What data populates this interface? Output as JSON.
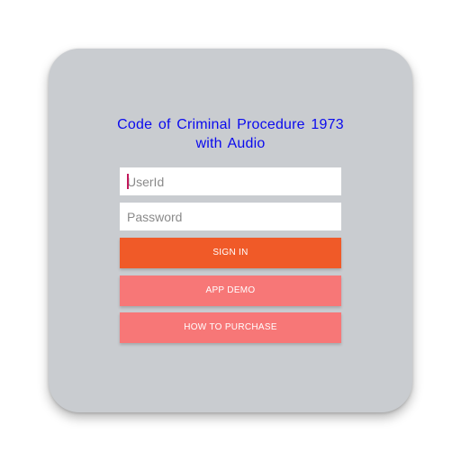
{
  "app": {
    "title_line1": "Code of Criminal Procedure 1973",
    "title_line2": "with Audio"
  },
  "login": {
    "userid_placeholder": "UserId",
    "password_placeholder": "Password",
    "signin_label": "SIGN IN",
    "demo_label": "APP DEMO",
    "purchase_label": "HOW TO PURCHASE"
  },
  "colors": {
    "title": "#0a0aee",
    "card_background": "#c9ccd0",
    "signin_button": "#f05a28",
    "secondary_buttons": "#f77777",
    "caret": "#c2185b"
  }
}
